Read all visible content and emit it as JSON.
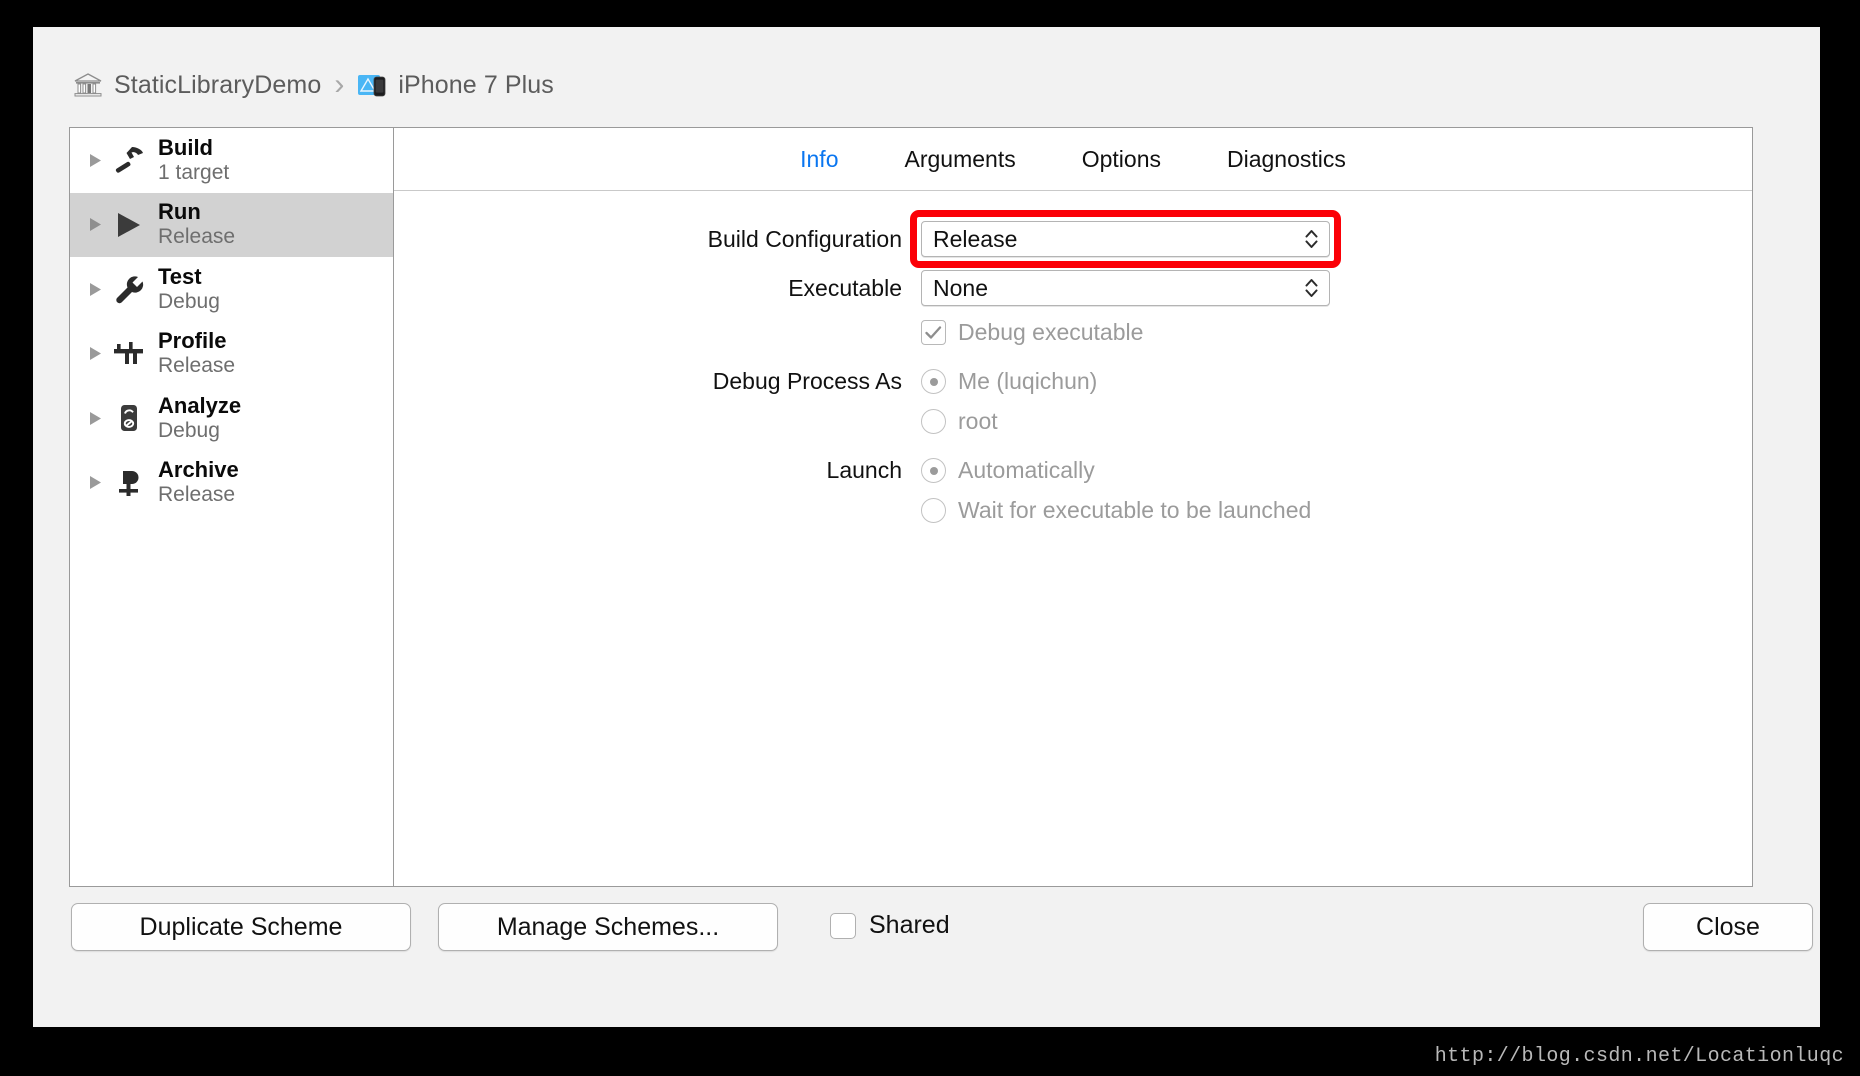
{
  "window": {
    "breadcrumb": {
      "project_icon": "bank-icon",
      "project": "StaticLibraryDemo",
      "separator": "›",
      "device_icon": "device-icon",
      "device": "iPhone 7 Plus"
    }
  },
  "sidebar": {
    "items": [
      {
        "title": "Build",
        "subtitle": "1 target",
        "icon": "hammer-icon",
        "selected": false
      },
      {
        "title": "Run",
        "subtitle": "Release",
        "icon": "play-icon",
        "selected": true
      },
      {
        "title": "Test",
        "subtitle": "Debug",
        "icon": "wrench-icon",
        "selected": false
      },
      {
        "title": "Profile",
        "subtitle": "Release",
        "icon": "caliper-icon",
        "selected": false
      },
      {
        "title": "Analyze",
        "subtitle": "Debug",
        "icon": "analyze-icon",
        "selected": false
      },
      {
        "title": "Archive",
        "subtitle": "Release",
        "icon": "archive-icon",
        "selected": false
      }
    ]
  },
  "tabs": [
    {
      "label": "Info",
      "active": true
    },
    {
      "label": "Arguments",
      "active": false
    },
    {
      "label": "Options",
      "active": false
    },
    {
      "label": "Diagnostics",
      "active": false
    }
  ],
  "form": {
    "build_configuration": {
      "label": "Build Configuration",
      "value": "Release",
      "highlighted": true
    },
    "executable": {
      "label": "Executable",
      "value": "None"
    },
    "debug_executable": {
      "label": "Debug executable",
      "checked": true,
      "enabled": false
    },
    "debug_process_as": {
      "label": "Debug Process As",
      "options": [
        {
          "label": "Me (luqichun)",
          "selected": true
        },
        {
          "label": "root",
          "selected": false
        }
      ]
    },
    "launch": {
      "label": "Launch",
      "options": [
        {
          "label": "Automatically",
          "selected": true
        },
        {
          "label": "Wait for executable to be launched",
          "selected": false
        }
      ]
    }
  },
  "bottom_bar": {
    "duplicate_scheme": "Duplicate Scheme",
    "manage_schemes": "Manage Schemes...",
    "shared": {
      "label": "Shared",
      "checked": false
    },
    "close": "Close"
  },
  "footer": {
    "watermark": "http://blog.csdn.net/Locationluqc"
  },
  "colors": {
    "accent_blue": "#0a76f0",
    "annotation_red": "#fb0007",
    "selected_row": "#d2d2d2",
    "disabled_text": "#9b9b9b"
  }
}
